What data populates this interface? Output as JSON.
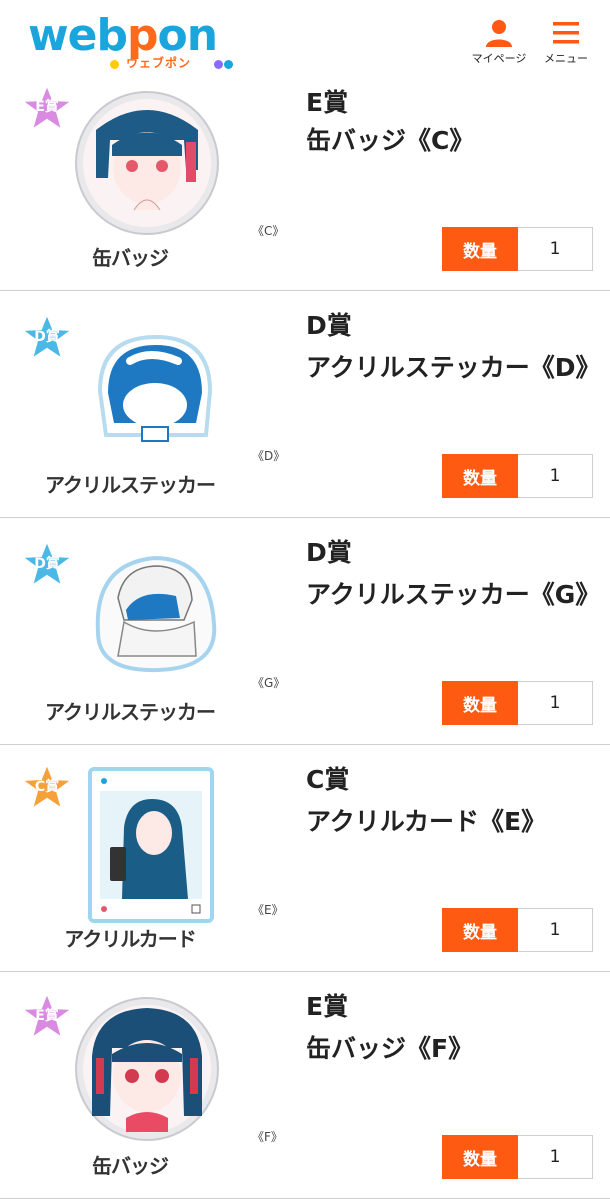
{
  "header": {
    "logo_text": "webpon",
    "logo_sub": "ウェブポン",
    "mypage_label": "マイページ",
    "menu_label": "メニュー"
  },
  "colors": {
    "accent": "#ff5a12",
    "logo_blue": "#1aa6dc",
    "badge_e": "#d88be0",
    "badge_d": "#4bb8e6",
    "badge_c": "#f5a13a"
  },
  "items": [
    {
      "badge": "E賞",
      "prize": "E賞",
      "title": "缶バッジ《C》",
      "product_label": "缶バッジ",
      "variant": "《C》",
      "qty_label": "数量",
      "qty_value": "1",
      "image": "can-badge-portrait"
    },
    {
      "badge": "D賞",
      "prize": "D賞",
      "title": "アクリルステッカー《D》",
      "product_label": "アクリルステッカー",
      "variant": "《D》",
      "qty_label": "数量",
      "qty_value": "1",
      "image": "acrylic-sticker-chibi"
    },
    {
      "badge": "D賞",
      "prize": "D賞",
      "title": "アクリルステッカー《G》",
      "product_label": "アクリルステッカー",
      "variant": "《G》",
      "qty_label": "数量",
      "qty_value": "1",
      "image": "acrylic-sticker-blanket"
    },
    {
      "badge": "C賞",
      "prize": "C賞",
      "title": "アクリルカード《E》",
      "product_label": "アクリルカード",
      "variant": "《E》",
      "qty_label": "数量",
      "qty_value": "1",
      "image": "acrylic-card-selfie"
    },
    {
      "badge": "E賞",
      "prize": "E賞",
      "title": "缶バッジ《F》",
      "product_label": "缶バッジ",
      "variant": "《F》",
      "qty_label": "数量",
      "qty_value": "1",
      "image": "can-badge-portrait"
    }
  ]
}
